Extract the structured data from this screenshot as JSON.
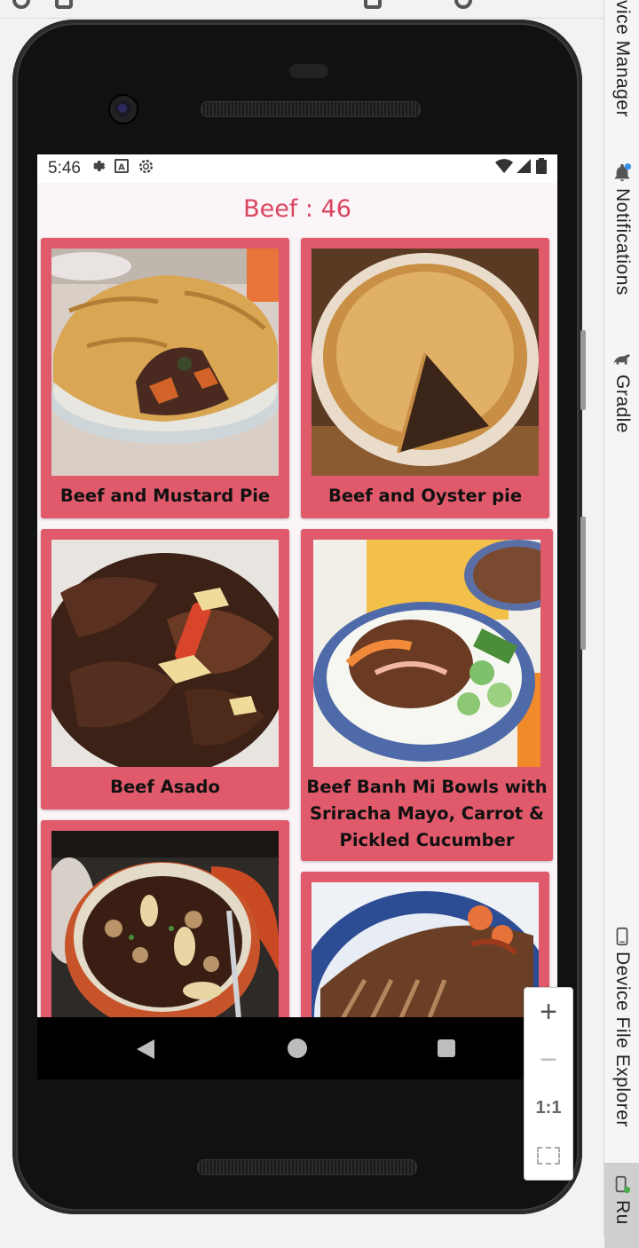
{
  "app": {
    "title": "Beef : 46"
  },
  "status_bar": {
    "time": "5:46",
    "left_icons": [
      "gear-icon",
      "a-icon",
      "settings-icon"
    ],
    "right_icons": [
      "wifi-icon",
      "signal-icon",
      "battery-icon"
    ]
  },
  "meals": [
    {
      "name": "Beef and Mustard Pie",
      "image": "pie-photo"
    },
    {
      "name": "Beef and Oyster pie",
      "image": "pie-slice-photo"
    },
    {
      "name": "Beef Asado",
      "image": "stew-photo"
    },
    {
      "name": "Beef Banh Mi Bowls with Sriracha Mayo, Carrot & Pickled Cucumber",
      "image": "rice-bowl-photo"
    },
    {
      "name": "",
      "image": "casserole-photo"
    },
    {
      "name": "",
      "image": "brisket-photo"
    }
  ],
  "ide_panels": {
    "device_manager": "vice Manager",
    "notifications": "Notifications",
    "gradle": "Gradle",
    "device_file_explorer": "Device File Explorer",
    "running": "Ru"
  },
  "zoom_controls": {
    "zoom_in": "+",
    "zoom_out": "−",
    "actual_size": "1:1"
  },
  "colors": {
    "accent": "#d9455f",
    "card": "#e05a6c",
    "background": "#fcf5f8"
  }
}
